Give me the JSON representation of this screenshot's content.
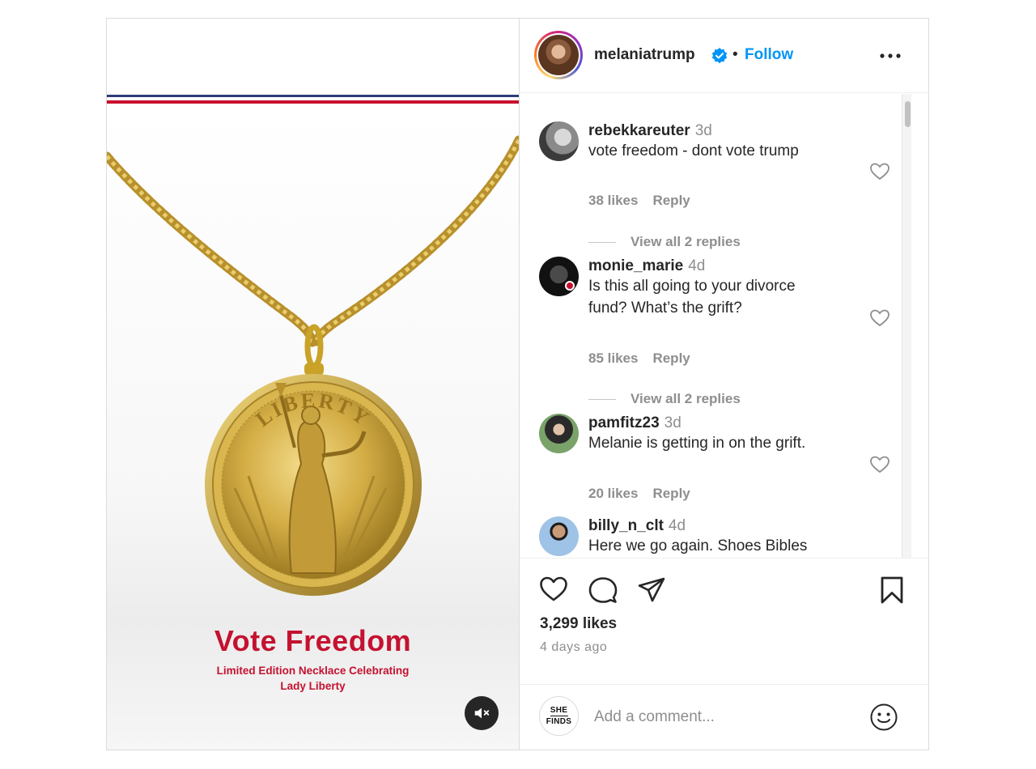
{
  "colors": {
    "stripe_blue": "#2f3b7a",
    "stripe_red": "#c8102e",
    "title_red": "#c41230",
    "link_blue": "#0095f6",
    "verified_blue": "#0095f6",
    "gold": "#c9a227"
  },
  "media": {
    "title": "Vote Freedom",
    "subtitle_line1": "Limited Edition Necklace Celebrating",
    "subtitle_line2": "Lady Liberty",
    "coin_text": "LIBERTY",
    "mute_icon": "speaker-muted-icon"
  },
  "header": {
    "username": "melaniatrump",
    "separator": "•",
    "follow_label": "Follow",
    "more_icon": "more-horizontal-icon"
  },
  "comments": [
    {
      "user": "rebekkareuter",
      "time": "3d",
      "text": [
        "vote freedom - dont vote trump"
      ],
      "likes": "38 likes",
      "reply": "Reply",
      "view_replies": "View all 2 replies"
    },
    {
      "user": "monie_marie",
      "time": "4d",
      "text": [
        "Is this all going to your divorce",
        "fund? What’s the grift?"
      ],
      "likes": "85 likes",
      "reply": "Reply",
      "view_replies": "View all 2 replies"
    },
    {
      "user": "pamfitz23",
      "time": "3d",
      "text": [
        "Melanie is getting in on the grift."
      ],
      "likes": "20 likes",
      "reply": "Reply"
    },
    {
      "user": "billy_n_clt",
      "time": "4d",
      "text": [
        "Here we go again. Shoes Bibles"
      ]
    }
  ],
  "footer": {
    "likes": "3,299 likes",
    "ago": "4 days ago",
    "commenter_avatar_line1": "SHE",
    "commenter_avatar_line2": "FINDS",
    "comment_placeholder": "Add a comment..."
  }
}
